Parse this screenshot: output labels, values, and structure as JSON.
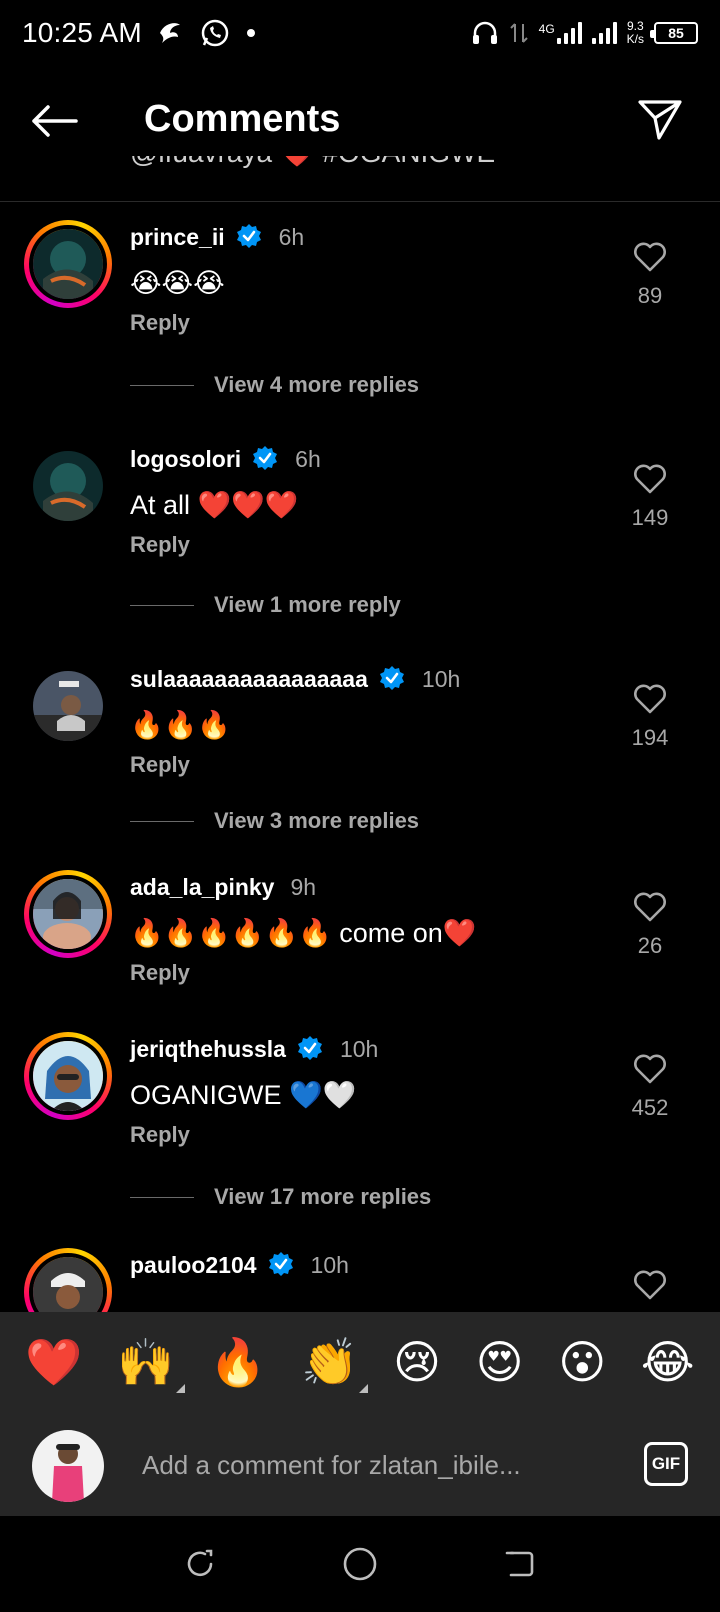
{
  "status_bar": {
    "time": "10:25 AM",
    "network_type": "4G",
    "net_speed_value": "9.3",
    "net_speed_unit": "K/s",
    "battery": "85"
  },
  "header": {
    "title": "Comments",
    "back_icon": "arrow-left-icon",
    "send_icon": "send-icon"
  },
  "caption_partial": "@ifuavraya ❤️ #OGANIGWE",
  "comments": [
    {
      "username": "prince_ii",
      "verified": true,
      "time": "6h",
      "text": "😭😭😭",
      "reply_label": "Reply",
      "likes": "89",
      "view_replies": "View 4 more replies",
      "story_ring": true
    },
    {
      "username": "logosolori",
      "verified": true,
      "time": "6h",
      "text": "At all ❤️❤️❤️",
      "reply_label": "Reply",
      "likes": "149",
      "view_replies": "View 1 more reply",
      "story_ring": false
    },
    {
      "username": "sulaaaaaaaaaaaaaaaa",
      "verified": true,
      "time": "10h",
      "text": "🔥🔥🔥",
      "reply_label": "Reply",
      "likes": "194",
      "view_replies": "View 3 more replies",
      "story_ring": false
    },
    {
      "username": "ada_la_pinky",
      "verified": false,
      "time": "9h",
      "text": "🔥🔥🔥🔥🔥🔥 come on❤️",
      "reply_label": "Reply",
      "likes": "26",
      "view_replies": "",
      "story_ring": true
    },
    {
      "username": "jeriqthehussla",
      "verified": true,
      "time": "10h",
      "text": "OGANIGWE 💙🤍",
      "reply_label": "Reply",
      "likes": "452",
      "view_replies": "View 17 more replies",
      "story_ring": true
    },
    {
      "username": "pauloo2104",
      "verified": true,
      "time": "10h",
      "text": "",
      "reply_label": "",
      "likes": "",
      "view_replies": "",
      "story_ring": true
    }
  ],
  "emoji_bar": [
    "❤️",
    "🙌",
    "🔥",
    "👏",
    "😢",
    "😍",
    "😮",
    "😂"
  ],
  "input": {
    "placeholder": "Add a comment for zlatan_ibile...",
    "gif_label": "GIF"
  },
  "colors": {
    "background": "#000000",
    "panel": "#262626",
    "secondary_text": "#a8a8a8",
    "verified_blue": "#0095f6"
  }
}
